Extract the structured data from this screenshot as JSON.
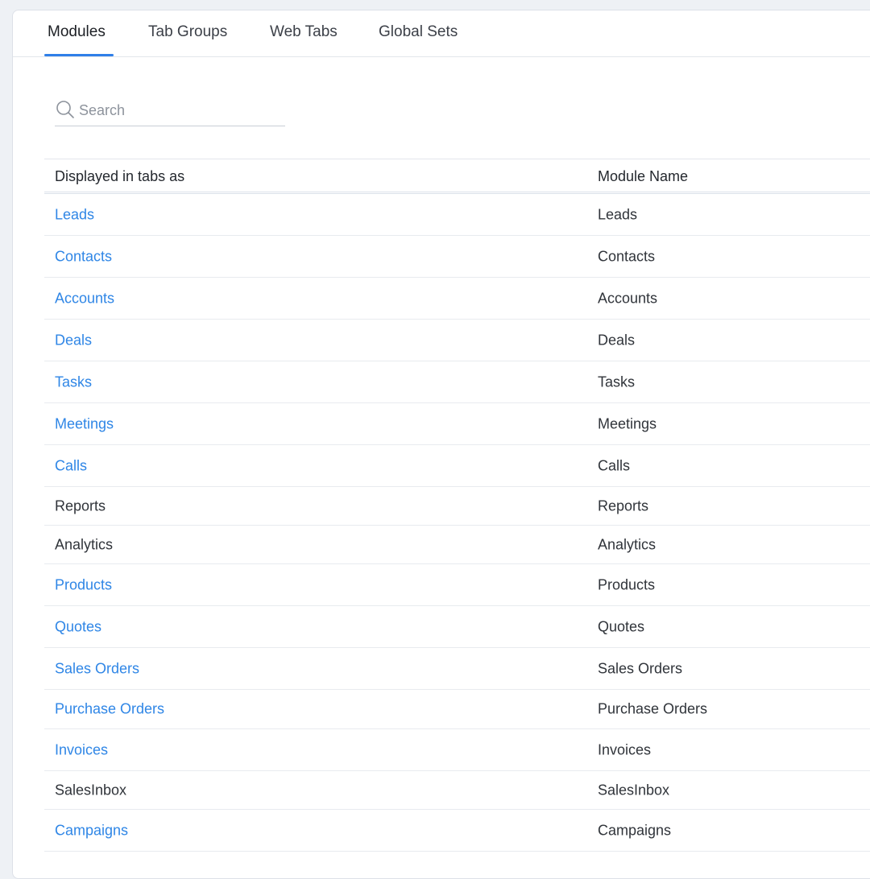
{
  "tabs": [
    {
      "label": "Modules",
      "active": true
    },
    {
      "label": "Tab Groups",
      "active": false
    },
    {
      "label": "Web Tabs",
      "active": false
    },
    {
      "label": "Global Sets",
      "active": false
    }
  ],
  "search": {
    "placeholder": "Search",
    "value": ""
  },
  "table": {
    "headers": [
      "Displayed in tabs as",
      "Module Name"
    ],
    "rows": [
      {
        "display": "Leads",
        "module": "Leads",
        "link": true
      },
      {
        "display": "Contacts",
        "module": "Contacts",
        "link": true
      },
      {
        "display": "Accounts",
        "module": "Accounts",
        "link": true
      },
      {
        "display": "Deals",
        "module": "Deals",
        "link": true
      },
      {
        "display": "Tasks",
        "module": "Tasks",
        "link": true
      },
      {
        "display": "Meetings",
        "module": "Meetings",
        "link": true
      },
      {
        "display": "Calls",
        "module": "Calls",
        "link": true
      },
      {
        "display": "Reports",
        "module": "Reports",
        "link": false
      },
      {
        "display": "Analytics",
        "module": "Analytics",
        "link": false
      },
      {
        "display": "Products",
        "module": "Products",
        "link": true
      },
      {
        "display": "Quotes",
        "module": "Quotes",
        "link": true
      },
      {
        "display": "Sales Orders",
        "module": "Sales Orders",
        "link": true
      },
      {
        "display": "Purchase Orders",
        "module": "Purchase Orders",
        "link": true
      },
      {
        "display": "Invoices",
        "module": "Invoices",
        "link": true
      },
      {
        "display": "SalesInbox",
        "module": "SalesInbox",
        "link": false
      },
      {
        "display": "Campaigns",
        "module": "Campaigns",
        "link": true
      }
    ]
  },
  "colors": {
    "accent": "#2f7fe8",
    "link": "#2f86e6",
    "background": "#eef1f5"
  },
  "icons": {
    "search": "search-icon"
  }
}
